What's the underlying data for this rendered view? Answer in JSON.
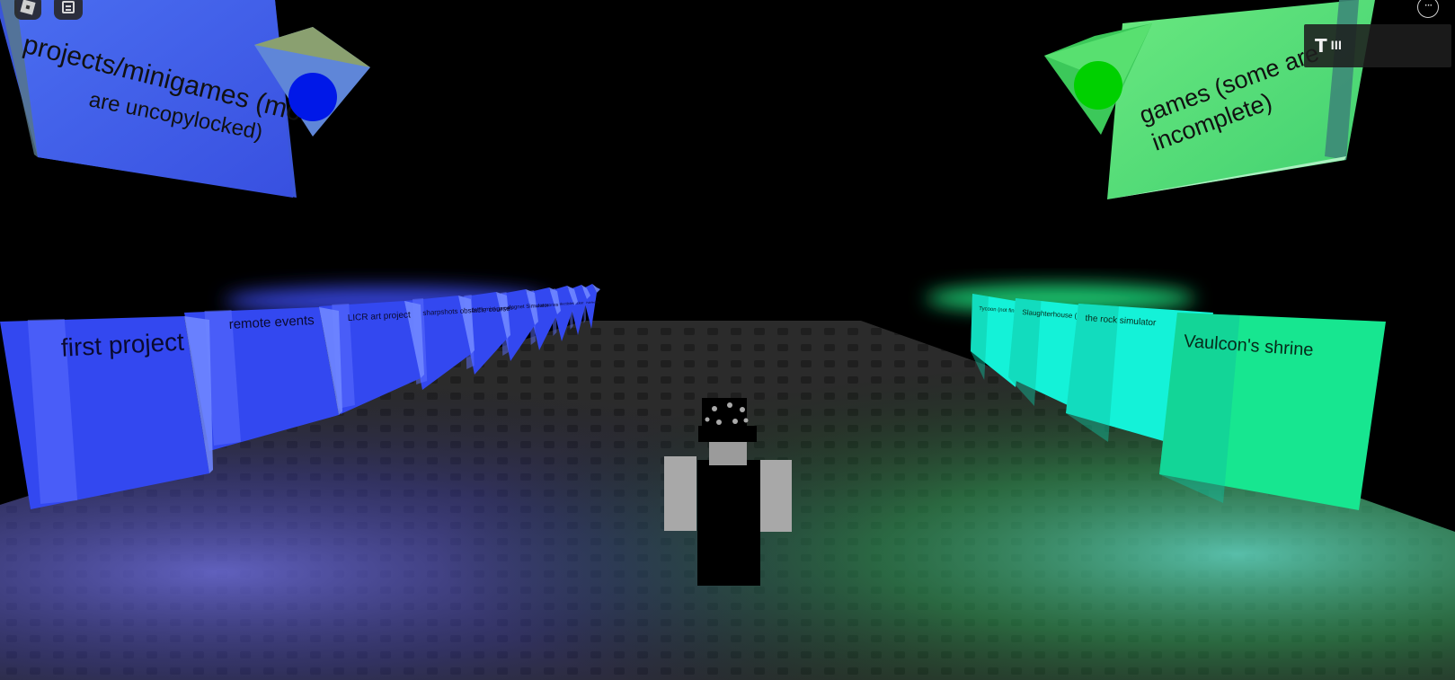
{
  "hud": {
    "roblox_menu_icon": "roblox-logo-icon",
    "chat_icon": "chat-icon",
    "more_icon": "more-options-icon",
    "more_glyph": "···",
    "tool_icon": "hammer-icon",
    "tool_glyph": "T",
    "signal_glyph": "lll"
  },
  "signs": {
    "left": {
      "line1": "projects/minigames (most",
      "line2": "are uncopylocked)",
      "color": "#4060e8"
    },
    "right": {
      "line1": "games (some are",
      "line2": "incomplete)",
      "color": "#4ee070"
    }
  },
  "left_blocks": [
    "first project",
    "remote events",
    "LICR art project",
    "sharpshots obstacle course",
    "Jeff's mini games",
    "Magnet Simulator",
    "Accessories",
    "Collectibles",
    "Clicker",
    "Pathfinding"
  ],
  "right_blocks": [
    "Vaulcon's shrine",
    "the rock simulator",
    "Slaughterhouse (Maze game)",
    "Tycoon (not fin.)"
  ],
  "colors": {
    "blue_block": "#3348f0",
    "green_block": "#17e690",
    "cyan_block": "#14f2d8",
    "floor": "#2a2a2a",
    "sky": "#000000"
  }
}
